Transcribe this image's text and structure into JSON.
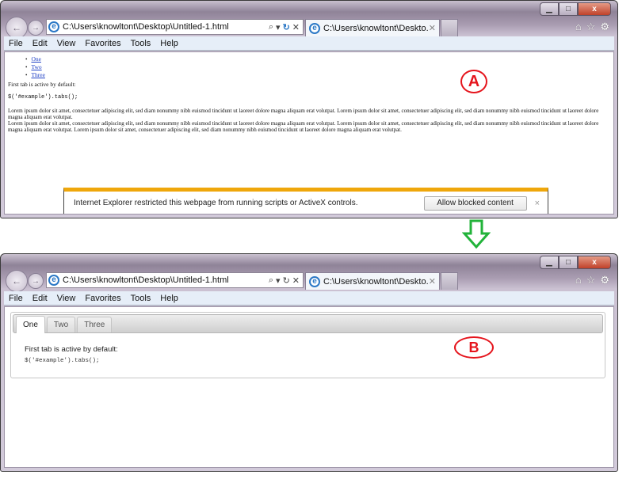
{
  "browser": {
    "address": "C:\\Users\\knowltont\\Desktop\\Untitled-1.html",
    "tab_title": "C:\\Users\\knowltont\\Deskto...",
    "window_controls": {
      "minimize": "▁",
      "maximize": "□",
      "close": "x"
    },
    "address_tools": {
      "search": "⌕",
      "dropdown": "▾",
      "refresh": "↻",
      "stop": "✕"
    },
    "right_icons": {
      "home": "⌂",
      "favorites": "☆",
      "settings": "⚙"
    },
    "nav": {
      "back": "←",
      "forward": "→"
    },
    "menu": [
      "File",
      "Edit",
      "View",
      "Favorites",
      "Tools",
      "Help"
    ]
  },
  "window_a": {
    "list_items": [
      "One",
      "Two",
      "Three"
    ],
    "first_tab_text": "First tab is active by default:",
    "code": "$('#example').tabs();",
    "lorem": [
      "Lorem ipsum dolor sit amet, consectetuer adipiscing elit, sed diam nonummy nibh euismod tincidunt ut laoreet dolore magna aliquam erat volutpat. Lorem ipsum dolor sit amet, consectetuer adipiscing elit, sed diam nonummy nibh euismod tincidunt ut laoreet dolore magna aliquam erat volutpat.",
      "Lorem ipsum dolor sit amet, consectetuer adipiscing elit, sed diam nonummy nibh euismod tincidunt ut laoreet dolore magna aliquam erat volutpat. Lorem ipsum dolor sit amet, consectetuer adipiscing elit, sed diam nonummy nibh euismod tincidunt ut laoreet dolore magna aliquam erat volutpat. Lorem ipsum dolor sit amet, consectetuer adipiscing elit, sed diam nonummy nibh euismod tincidunt ut laoreet dolore magna aliquam erat volutpat."
    ],
    "infobar": {
      "message": "Internet Explorer restricted this webpage from running scripts or ActiveX controls.",
      "allow_label": "Allow blocked content",
      "close": "×",
      "accent": "#efa70b"
    },
    "marker": "A"
  },
  "window_b": {
    "tabs": [
      {
        "label": "One",
        "active": true
      },
      {
        "label": "Two",
        "active": false
      },
      {
        "label": "Three",
        "active": false
      }
    ],
    "first_tab_text": "First tab is active by default:",
    "code": "$('#example').tabs();",
    "marker": "B"
  },
  "annotation_colors": {
    "marker": "#e5141c",
    "arrow": "#22b33a"
  }
}
